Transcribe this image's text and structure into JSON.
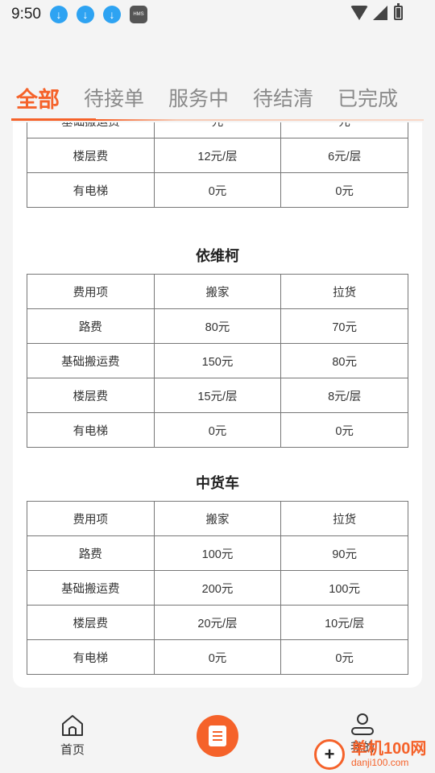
{
  "status": {
    "time": "9:50"
  },
  "tabs": [
    {
      "label": "全部",
      "active": true
    },
    {
      "label": "待接单"
    },
    {
      "label": "服务中"
    },
    {
      "label": "待结清"
    },
    {
      "label": "已完成"
    }
  ],
  "sections": {
    "partial": {
      "rows": [
        [
          "基础搬运费",
          "元",
          "元"
        ],
        [
          "楼层费",
          "12元/层",
          "6元/层"
        ],
        [
          "有电梯",
          "0元",
          "0元"
        ]
      ]
    },
    "yiweike": {
      "title": "依维柯",
      "rows": [
        [
          "费用项",
          "搬家",
          "拉货"
        ],
        [
          "路费",
          "80元",
          "70元"
        ],
        [
          "基础搬运费",
          "150元",
          "80元"
        ],
        [
          "楼层费",
          "15元/层",
          "8元/层"
        ],
        [
          "有电梯",
          "0元",
          "0元"
        ]
      ]
    },
    "zhonghuoche": {
      "title": "中货车",
      "rows": [
        [
          "费用项",
          "搬家",
          "拉货"
        ],
        [
          "路费",
          "100元",
          "90元"
        ],
        [
          "基础搬运费",
          "200元",
          "100元"
        ],
        [
          "楼层费",
          "20元/层",
          "10元/层"
        ],
        [
          "有电梯",
          "0元",
          "0元"
        ]
      ]
    }
  },
  "nav": {
    "home": "首页",
    "me": "我的"
  },
  "watermark": {
    "line1": "单机100网",
    "line2": "danji100.com"
  },
  "colors": {
    "accent": "#f5622a",
    "statusIcon": "#2ea3f2"
  }
}
